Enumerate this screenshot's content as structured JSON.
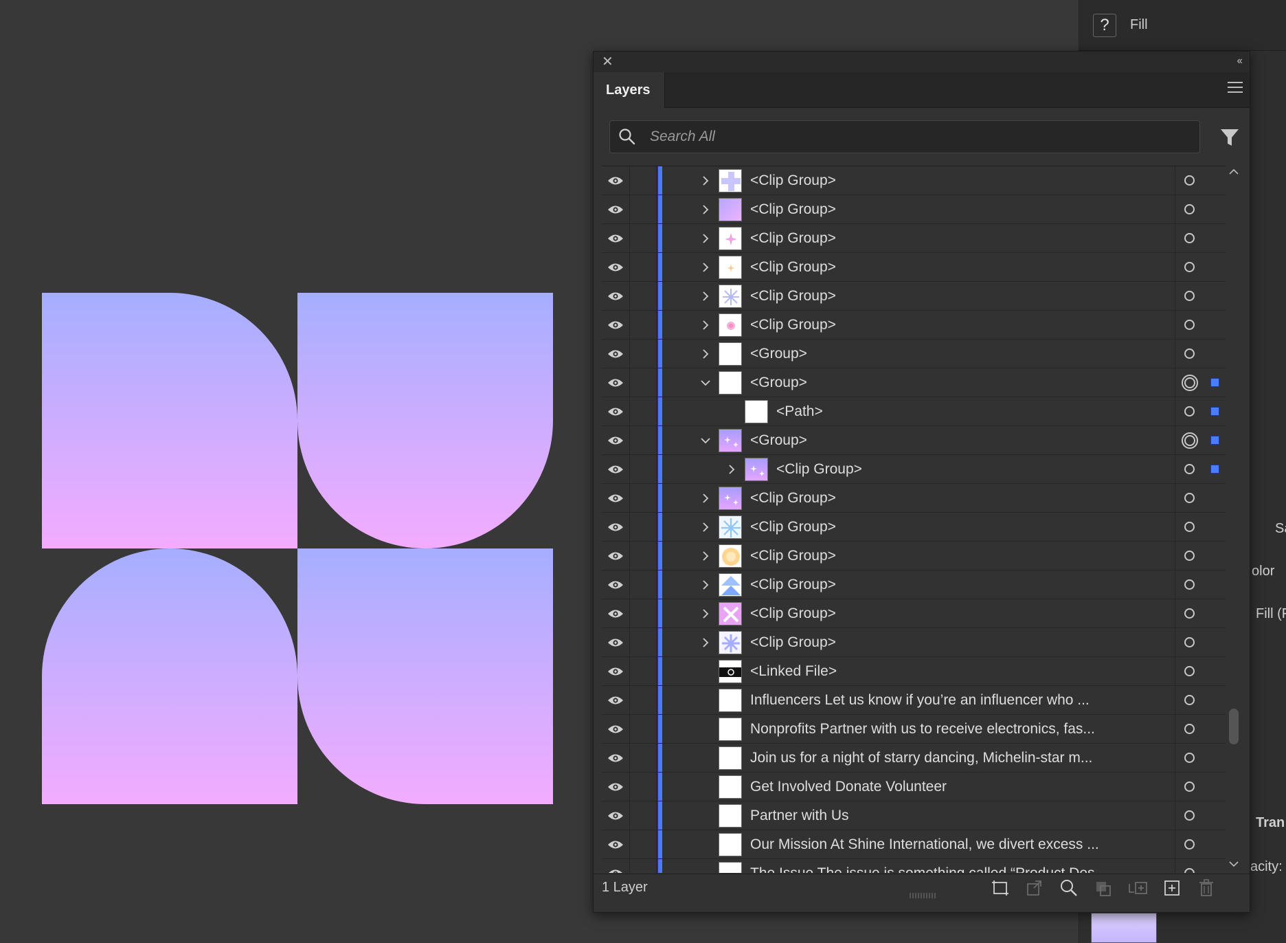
{
  "dock": {
    "help_icon": "?",
    "fill_label": "Fill",
    "frag_sa": "Sa",
    "frag_color": "olor",
    "frag_fill": "Fill (F",
    "frag_transparency": "Tran",
    "frag_opacity": "acity:"
  },
  "panel": {
    "tab_label": "Layers",
    "search_placeholder": "Search All",
    "layer_count": "1 Layer"
  },
  "colors": {
    "background": "#383838",
    "panel": "#323232",
    "layer_color": "#4d79ff",
    "gradient_top": "#a6aeff",
    "gradient_bottom": "#f3acff"
  },
  "rows": [
    {
      "label": "<Clip Group>",
      "thumb": "cross",
      "expand": "collapsed",
      "level": 0,
      "target": "ring",
      "selected": false
    },
    {
      "label": "<Clip Group>",
      "thumb": "gradient",
      "expand": "collapsed",
      "level": 0,
      "target": "ring",
      "selected": false
    },
    {
      "label": "<Clip Group>",
      "thumb": "sparkle-pink",
      "expand": "collapsed",
      "level": 0,
      "target": "ring",
      "selected": false
    },
    {
      "label": "<Clip Group>",
      "thumb": "sparkle-orange",
      "expand": "collapsed",
      "level": 0,
      "target": "ring",
      "selected": false
    },
    {
      "label": "<Clip Group>",
      "thumb": "star-blue",
      "expand": "collapsed",
      "level": 0,
      "target": "ring",
      "selected": false
    },
    {
      "label": "<Clip Group>",
      "thumb": "flower-pink",
      "expand": "collapsed",
      "level": 0,
      "target": "ring",
      "selected": false
    },
    {
      "label": "<Group>",
      "thumb": "blank",
      "expand": "collapsed",
      "level": 0,
      "target": "ring",
      "selected": false
    },
    {
      "label": "<Group>",
      "thumb": "blank",
      "expand": "expanded",
      "level": 0,
      "target": "double",
      "selected": true
    },
    {
      "label": "<Path>",
      "thumb": "blank",
      "expand": "none",
      "level": 1,
      "target": "ring",
      "selected": true
    },
    {
      "label": "<Group>",
      "thumb": "purple-sparkle",
      "expand": "expanded",
      "level": 0,
      "target": "double",
      "selected": true
    },
    {
      "label": "<Clip Group>",
      "thumb": "purple-sparkle",
      "expand": "collapsed",
      "level": 1,
      "target": "ring",
      "selected": true
    },
    {
      "label": "<Clip Group>",
      "thumb": "purple-sparkle",
      "expand": "collapsed",
      "level": 0,
      "target": "ring",
      "selected": false
    },
    {
      "label": "<Clip Group>",
      "thumb": "snowflake",
      "expand": "collapsed",
      "level": 0,
      "target": "ring",
      "selected": false
    },
    {
      "label": "<Clip Group>",
      "thumb": "sunburst",
      "expand": "collapsed",
      "level": 0,
      "target": "ring",
      "selected": false
    },
    {
      "label": "<Clip Group>",
      "thumb": "triangles",
      "expand": "collapsed",
      "level": 0,
      "target": "ring",
      "selected": false
    },
    {
      "label": "<Clip Group>",
      "thumb": "x-pink",
      "expand": "collapsed",
      "level": 0,
      "target": "ring",
      "selected": false
    },
    {
      "label": "<Clip Group>",
      "thumb": "star-lavender",
      "expand": "collapsed",
      "level": 0,
      "target": "ring",
      "selected": false
    },
    {
      "label": "<Linked File>",
      "thumb": "linked",
      "expand": "none",
      "level": 0,
      "target": "ring",
      "selected": false
    },
    {
      "label": "Influencers Let us know if you’re an influencer who ...",
      "thumb": "blank",
      "expand": "none",
      "level": 0,
      "target": "ring",
      "selected": false
    },
    {
      "label": "Nonprofits Partner with us to receive electronics, fas...",
      "thumb": "blank",
      "expand": "none",
      "level": 0,
      "target": "ring",
      "selected": false
    },
    {
      "label": "Join us for a night of starry dancing, Michelin-star m...",
      "thumb": "blank",
      "expand": "none",
      "level": 0,
      "target": "ring",
      "selected": false
    },
    {
      "label": "Get Involved  Donate   Volunteer",
      "thumb": "blank",
      "expand": "none",
      "level": 0,
      "target": "ring",
      "selected": false
    },
    {
      "label": "Partner with Us",
      "thumb": "blank",
      "expand": "none",
      "level": 0,
      "target": "ring",
      "selected": false
    },
    {
      "label": "Our Mission At Shine International, we divert excess ...",
      "thumb": "blank",
      "expand": "none",
      "level": 0,
      "target": "ring",
      "selected": false
    },
    {
      "label": "The Issue The issue is something called “Product Des...",
      "thumb": "blank",
      "expand": "none",
      "level": 0,
      "target": "ring",
      "selected": false
    }
  ]
}
